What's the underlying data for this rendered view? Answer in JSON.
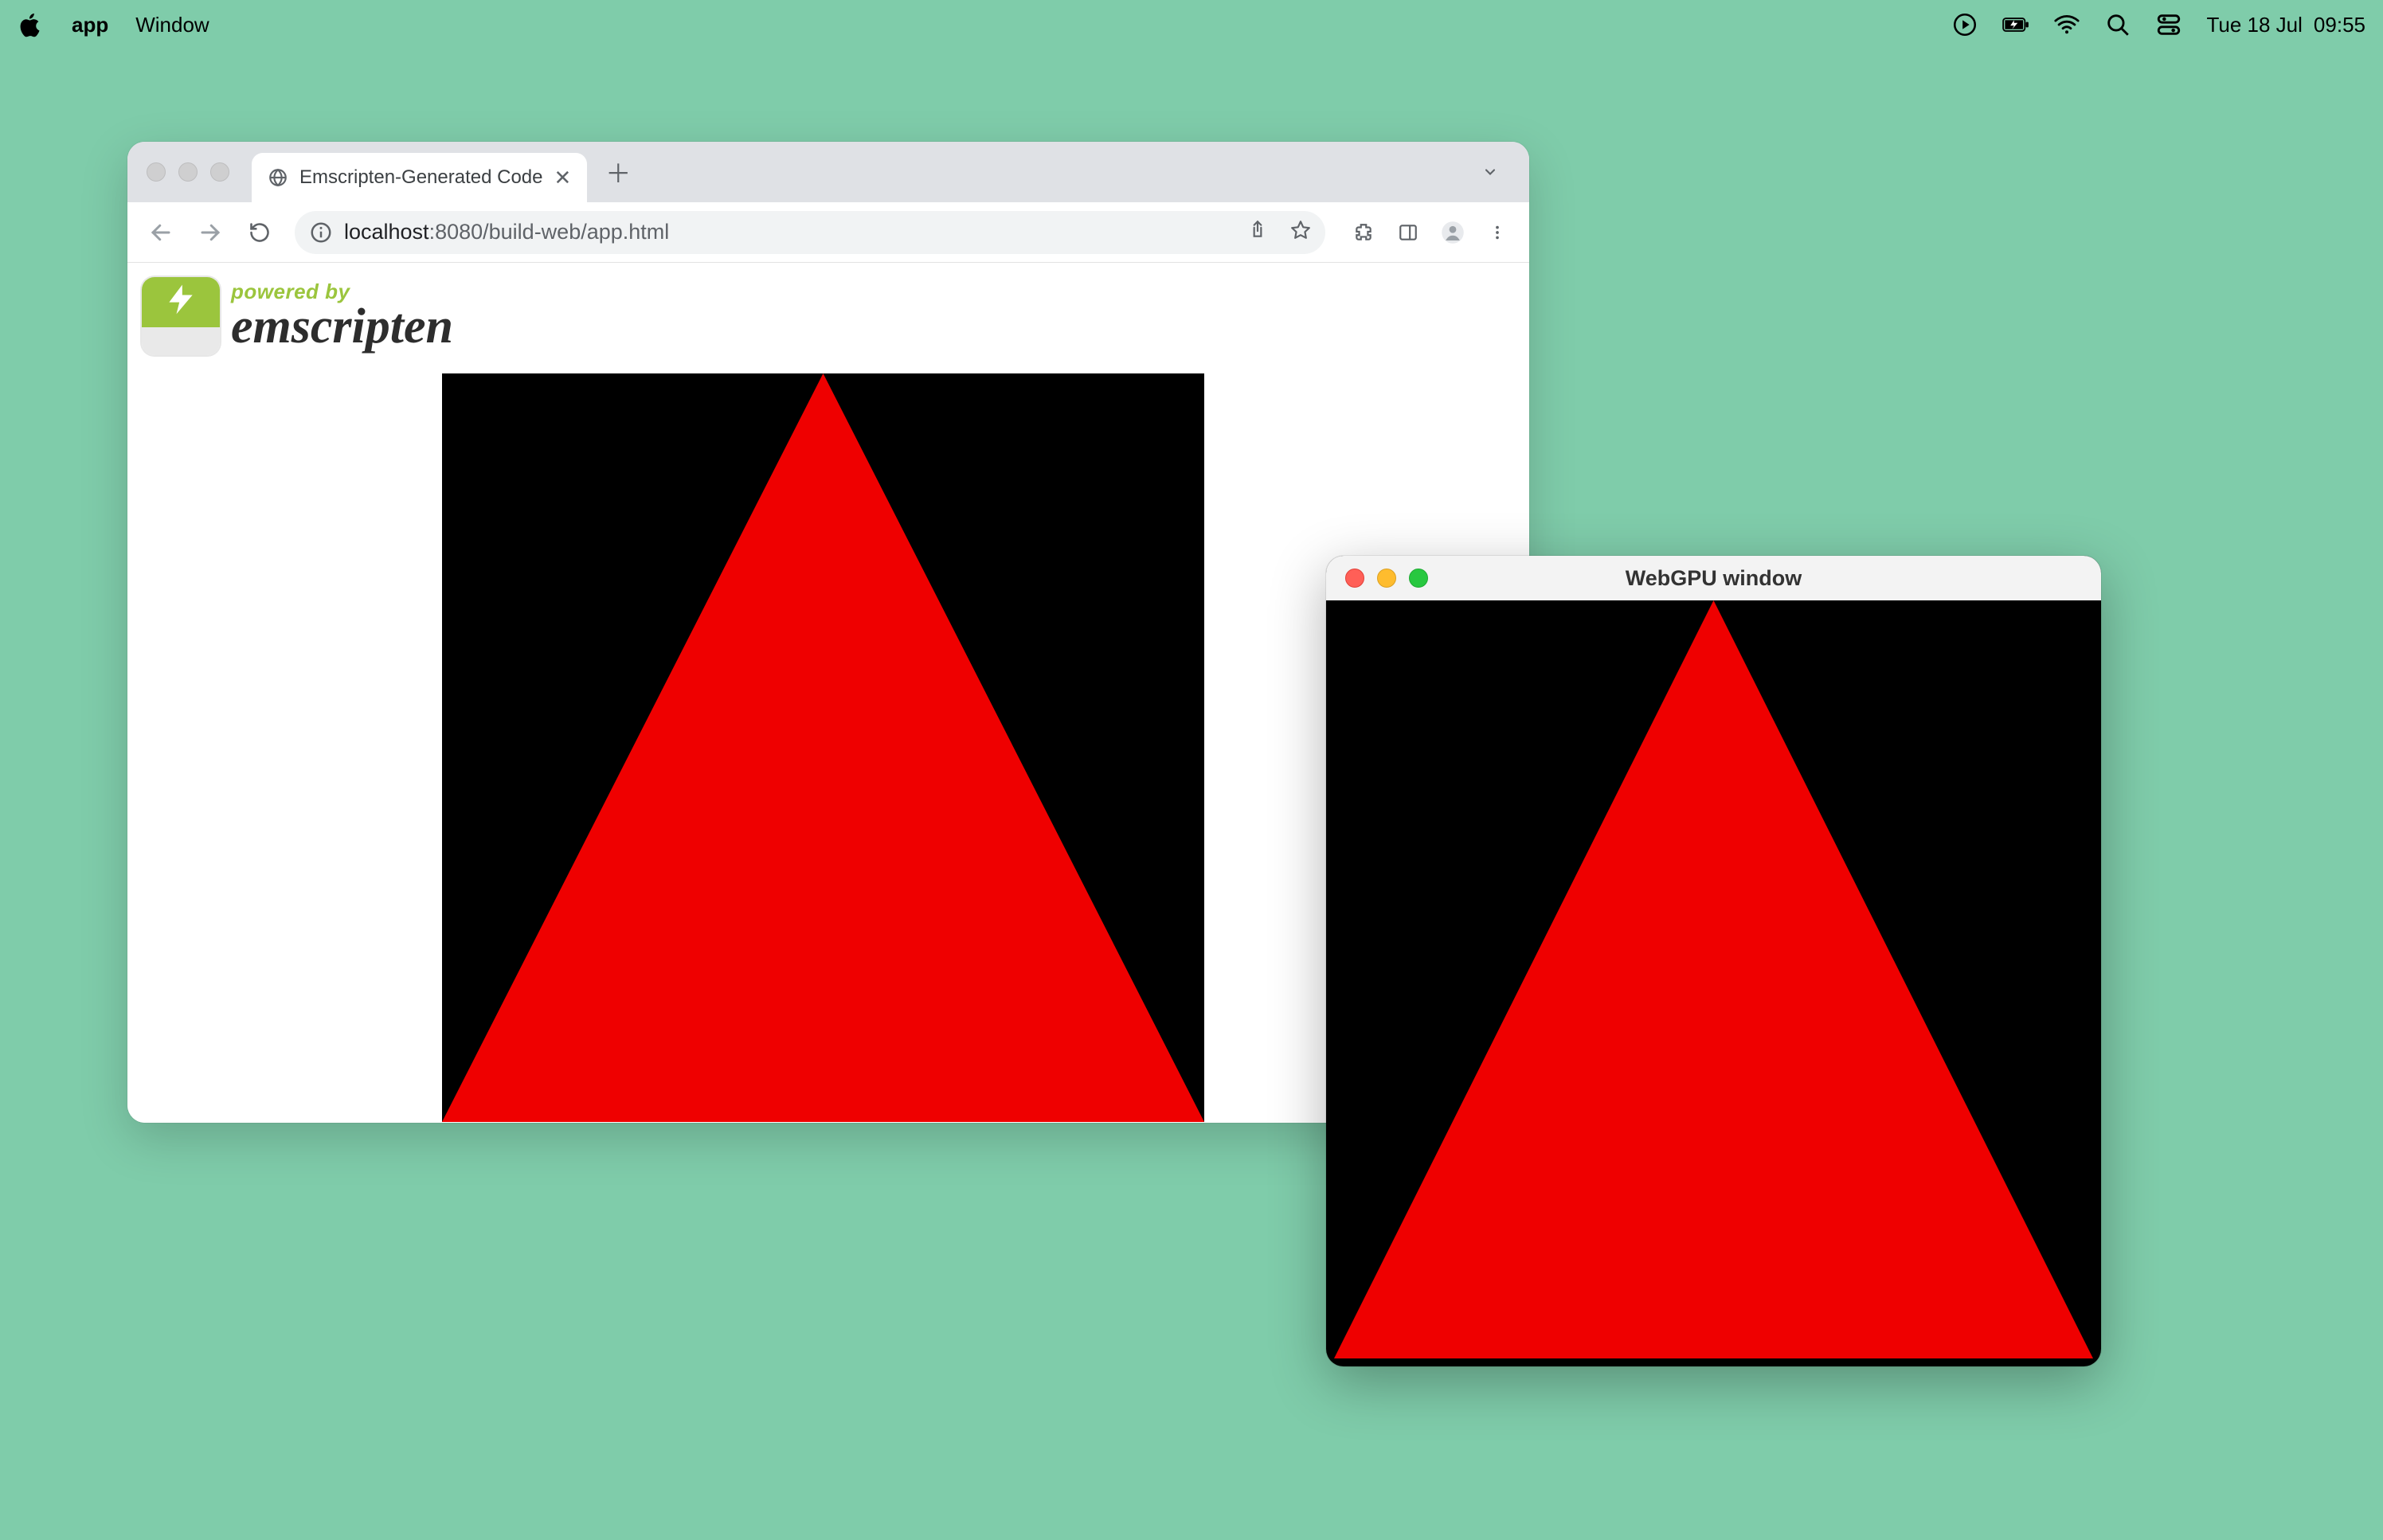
{
  "menubar": {
    "app_name": "app",
    "menus": [
      "Window"
    ],
    "date": "Tue 18 Jul",
    "time": "09:55"
  },
  "browser": {
    "tab_title": "Emscripten-Generated Code",
    "url_host": "localhost",
    "url_port_path": ":8080/build-web/app.html"
  },
  "emscripten": {
    "powered_by": "powered by",
    "name": "emscripten"
  },
  "native_window": {
    "title": "WebGPU window"
  },
  "colors": {
    "triangle": "#ef0000",
    "canvas_bg": "#000000",
    "desktop_bg": "#7fccaa"
  }
}
